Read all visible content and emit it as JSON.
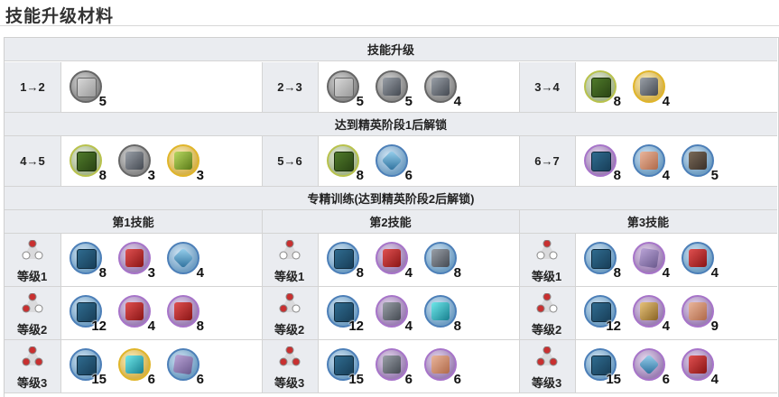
{
  "page_title": "技能升级材料",
  "sections": {
    "skill_upgrade": "技能升级",
    "elite1_unlock": "达到精英阶段1后解锁",
    "mastery": "专精训练(达到精英阶段2后解锁)"
  },
  "upgrade_rows": [
    [
      {
        "label": "1→2",
        "items": [
          {
            "icon": "grey-skill-book-icon",
            "tier": 1,
            "qty": "5"
          }
        ]
      },
      {
        "label": "2→3",
        "items": [
          {
            "icon": "grey-skill-book-icon",
            "tier": 1,
            "qty": "5"
          },
          {
            "icon": "metal-shard-icon",
            "tier": 1,
            "qty": "5"
          },
          {
            "icon": "ester-icon",
            "tier": 1,
            "qty": "4"
          }
        ]
      },
      {
        "label": "3→4",
        "items": [
          {
            "icon": "green-skill-book-icon",
            "tier": 2,
            "qty": "8"
          },
          {
            "icon": "syringe-icon",
            "tier": 5,
            "qty": "4"
          }
        ]
      }
    ],
    [
      {
        "label": "4→5",
        "items": [
          {
            "icon": "green-skill-book-icon",
            "tier": 2,
            "qty": "8"
          },
          {
            "icon": "device-icon",
            "tier": 1,
            "qty": "3"
          },
          {
            "icon": "green-block-icon",
            "tier": 5,
            "qty": "3"
          }
        ]
      },
      {
        "label": "5→6",
        "items": [
          {
            "icon": "green-skill-book-icon",
            "tier": 2,
            "qty": "8"
          },
          {
            "icon": "crystal-cluster-icon",
            "tier": 3,
            "qty": "6"
          }
        ]
      },
      {
        "label": "6→7",
        "items": [
          {
            "icon": "blue-skill-book-icon",
            "tier": 4,
            "qty": "8"
          },
          {
            "icon": "copper-plate-icon",
            "tier": 3,
            "qty": "4"
          },
          {
            "icon": "dark-rock-icon",
            "tier": 3,
            "qty": "5"
          }
        ]
      }
    ]
  ],
  "skill_headers": [
    "第1技能",
    "第2技能",
    "第3技能"
  ],
  "mastery_levels": [
    "等级1",
    "等级2",
    "等级3"
  ],
  "mastery_rows": [
    [
      {
        "items": [
          {
            "icon": "blue-skill-book-icon",
            "tier": 3,
            "qty": "8"
          },
          {
            "icon": "red-crystal-icon",
            "tier": 4,
            "qty": "3"
          },
          {
            "icon": "blue-polyhedron-icon",
            "tier": 3,
            "qty": "4"
          }
        ]
      },
      {
        "items": [
          {
            "icon": "blue-skill-book-icon",
            "tier": 3,
            "qty": "8"
          },
          {
            "icon": "red-device-icon",
            "tier": 4,
            "qty": "4"
          },
          {
            "icon": "orirock-capsule-icon",
            "tier": 3,
            "qty": "8"
          }
        ]
      },
      {
        "items": [
          {
            "icon": "blue-skill-book-icon",
            "tier": 3,
            "qty": "8"
          },
          {
            "icon": "purple-cube-icon",
            "tier": 4,
            "qty": "4"
          },
          {
            "icon": "red-crystal-icon",
            "tier": 3,
            "qty": "4"
          }
        ]
      }
    ],
    [
      {
        "items": [
          {
            "icon": "blue-skill-book-icon",
            "tier": 3,
            "qty": "12"
          },
          {
            "icon": "red-star-icon",
            "tier": 4,
            "qty": "4"
          },
          {
            "icon": "red-device-icon",
            "tier": 4,
            "qty": "8"
          }
        ]
      },
      {
        "items": [
          {
            "icon": "blue-skill-book-icon",
            "tier": 3,
            "qty": "12"
          },
          {
            "icon": "cylinder-icon",
            "tier": 4,
            "qty": "4"
          },
          {
            "icon": "cyan-crystal-icon",
            "tier": 3,
            "qty": "8"
          }
        ]
      },
      {
        "items": [
          {
            "icon": "blue-skill-book-icon",
            "tier": 3,
            "qty": "12"
          },
          {
            "icon": "gold-rock-icon",
            "tier": 4,
            "qty": "4"
          },
          {
            "icon": "copper-plate-icon",
            "tier": 4,
            "qty": "9"
          }
        ]
      }
    ],
    [
      {
        "items": [
          {
            "icon": "blue-skill-book-icon",
            "tier": 3,
            "qty": "15"
          },
          {
            "icon": "cyan-tank-icon",
            "tier": 5,
            "qty": "6"
          },
          {
            "icon": "purple-cube-icon",
            "tier": 3,
            "qty": "6"
          }
        ]
      },
      {
        "items": [
          {
            "icon": "blue-skill-book-icon",
            "tier": 3,
            "qty": "15"
          },
          {
            "icon": "silver-ore-icon",
            "tier": 4,
            "qty": "6"
          },
          {
            "icon": "copper-plate-icon",
            "tier": 4,
            "qty": "6"
          }
        ]
      },
      {
        "items": [
          {
            "icon": "blue-skill-book-icon",
            "tier": 3,
            "qty": "15"
          },
          {
            "icon": "green-crystal-icon",
            "tier": 4,
            "qty": "6"
          },
          {
            "icon": "red-crystal-icon",
            "tier": 4,
            "qty": "4"
          }
        ]
      }
    ]
  ]
}
